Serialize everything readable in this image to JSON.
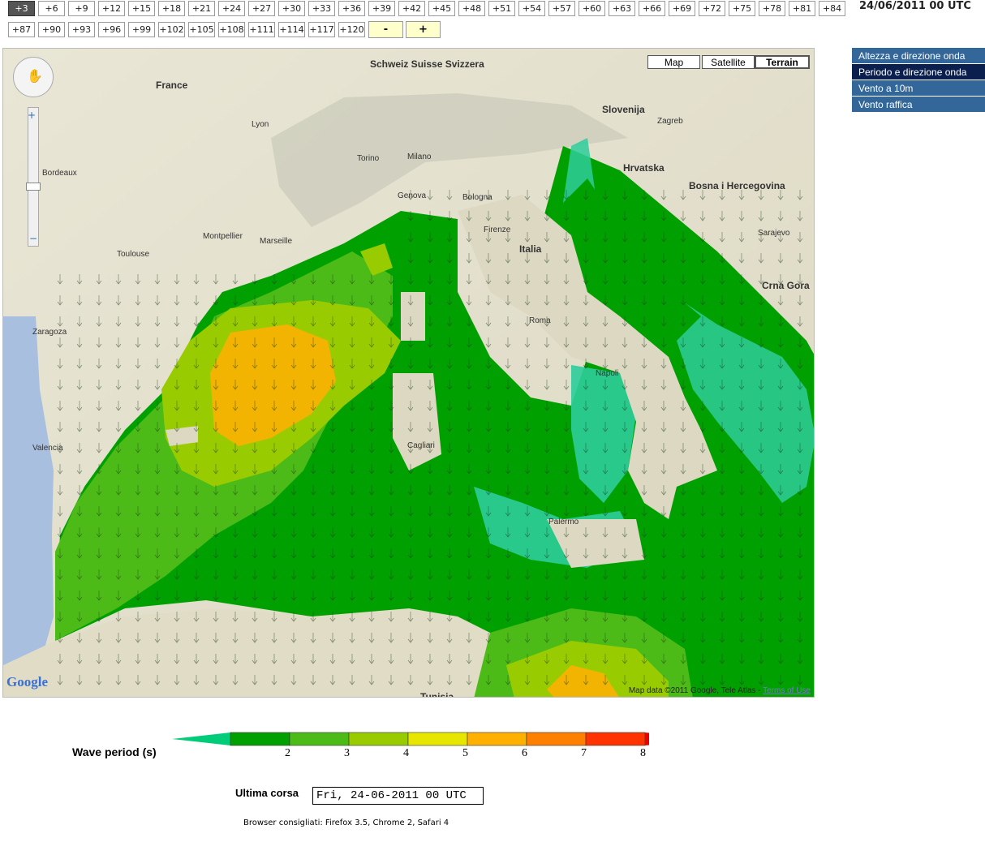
{
  "hours_row1": [
    "+3",
    "+6",
    "+9",
    "+12",
    "+15",
    "+18",
    "+21",
    "+24",
    "+27",
    "+30",
    "+33",
    "+36",
    "+39",
    "+42",
    "+45",
    "+48",
    "+51",
    "+54",
    "+57",
    "+60",
    "+63",
    "+66",
    "+69",
    "+72",
    "+75",
    "+78",
    "+81",
    "+84"
  ],
  "hours_row2": [
    "+87",
    "+90",
    "+93",
    "+96",
    "+99",
    "+102",
    "+105",
    "+108",
    "+111",
    "+114",
    "+117",
    "+120"
  ],
  "active_hour": "+3",
  "step_minus": "-",
  "step_plus": "+",
  "datetime": "24/06/2011 00 UTC",
  "map": {
    "types": [
      "Map",
      "Satellite",
      "Terrain"
    ],
    "selected_type": "Terrain",
    "attribution": "Map data ©2011 Google, Tele Atlas -",
    "terms": "Terms of Use",
    "logo": "Google",
    "labels": [
      "Schweiz Suisse Svizzera",
      "France",
      "Slovenija",
      "Hrvatska",
      "Bosna i Hercegovina",
      "Italia",
      "Crna Gora",
      "Zagreb",
      "Lyon",
      "Milano",
      "Torino",
      "Genova",
      "Bologna",
      "Firenze",
      "Roma",
      "Napoli",
      "Palermo",
      "Cagliari",
      "Toulouse",
      "Montpellier",
      "Marseille",
      "Zaragoza",
      "Valencia",
      "Sarajevo",
      "Tunisia",
      "Bordeaux"
    ]
  },
  "panel": {
    "items": [
      "Altezza e direzione onda",
      "Periodo e direzione onda",
      "Vento a 10m",
      "Vento raffica"
    ],
    "selected": "Periodo e direzione onda"
  },
  "legend": {
    "title": "Wave period  (s)",
    "ticks": [
      "2",
      "3",
      "4",
      "5",
      "6",
      "7",
      "8"
    ],
    "colors": [
      "#00cc7a",
      "#00a000",
      "#4cbb17",
      "#99cc00",
      "#e6e600",
      "#ffb000",
      "#ff7f00",
      "#ff3300",
      "#ee0000"
    ]
  },
  "ultima_label": "Ultima corsa",
  "ultima_value": "Fri, 24-06-2011 00 UTC",
  "browsers": "Browser consigliati: Firefox 3.5, Chrome 2, Safari 4"
}
